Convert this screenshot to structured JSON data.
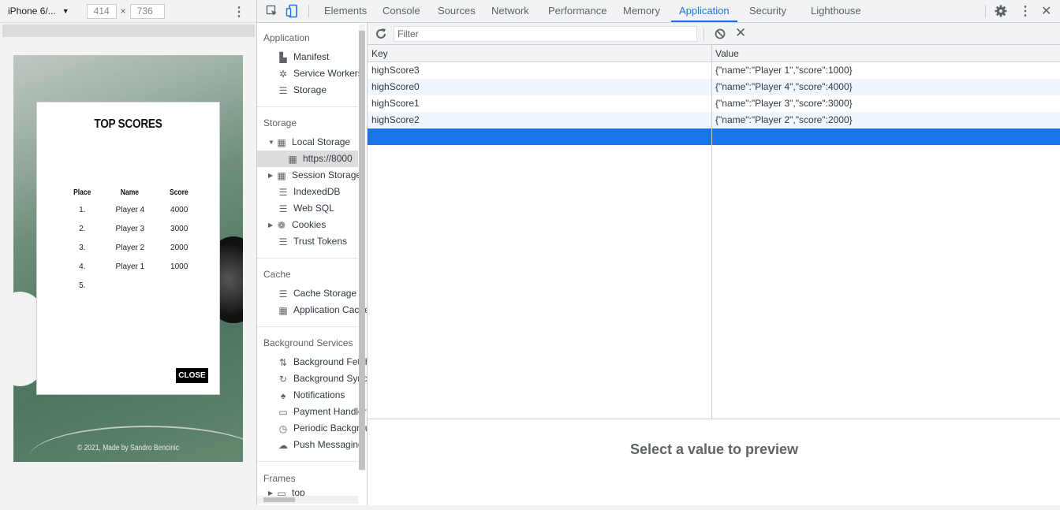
{
  "device_toolbar": {
    "device_name": "iPhone 6/...",
    "width": "414",
    "times": "×",
    "height": "736"
  },
  "phone": {
    "title": "TOP SCORES",
    "columns": [
      "Place",
      "Name",
      "Score"
    ],
    "rows": [
      {
        "place": "1.",
        "name": "Player 4",
        "score": "4000"
      },
      {
        "place": "2.",
        "name": "Player 3",
        "score": "3000"
      },
      {
        "place": "3.",
        "name": "Player 2",
        "score": "2000"
      },
      {
        "place": "4.",
        "name": "Player 1",
        "score": "1000"
      },
      {
        "place": "5.",
        "name": "",
        "score": ""
      }
    ],
    "close_label": "CLOSE",
    "footer": "© 2021, Made by Sandro Bencinic"
  },
  "devtools": {
    "tabs": [
      "Elements",
      "Console",
      "Sources",
      "Network",
      "Performance",
      "Memory",
      "Application",
      "Security",
      "Lighthouse"
    ],
    "active_tab": "Application",
    "accent_color": "#1a73e8"
  },
  "sidebar": {
    "sections": {
      "application": "Application",
      "storage": "Storage",
      "cache": "Cache",
      "background": "Background Services",
      "frames": "Frames"
    },
    "application_items": [
      "Manifest",
      "Service Workers",
      "Storage"
    ],
    "storage_items": {
      "local_storage": "Local Storage",
      "local_origin": "https://8000",
      "session_storage": "Session Storage",
      "indexeddb": "IndexedDB",
      "websql": "Web SQL",
      "cookies": "Cookies",
      "trust_tokens": "Trust Tokens"
    },
    "cache_items": [
      "Cache Storage",
      "Application Cache"
    ],
    "background_items": [
      "Background Fetch",
      "Background Sync",
      "Notifications",
      "Payment Handler",
      "Periodic Background Sync",
      "Push Messaging"
    ],
    "frames_item": "top"
  },
  "storage": {
    "filter_placeholder": "Filter",
    "columns": {
      "key": "Key",
      "value": "Value"
    },
    "rows": [
      {
        "key": "highScore3",
        "value": "{\"name\":\"Player 1\",\"score\":1000}"
      },
      {
        "key": "highScore0",
        "value": "{\"name\":\"Player 4\",\"score\":4000}"
      },
      {
        "key": "highScore1",
        "value": "{\"name\":\"Player 3\",\"score\":3000}"
      },
      {
        "key": "highScore2",
        "value": "{\"name\":\"Player 2\",\"score\":2000}"
      }
    ],
    "preview_message": "Select a value to preview"
  }
}
